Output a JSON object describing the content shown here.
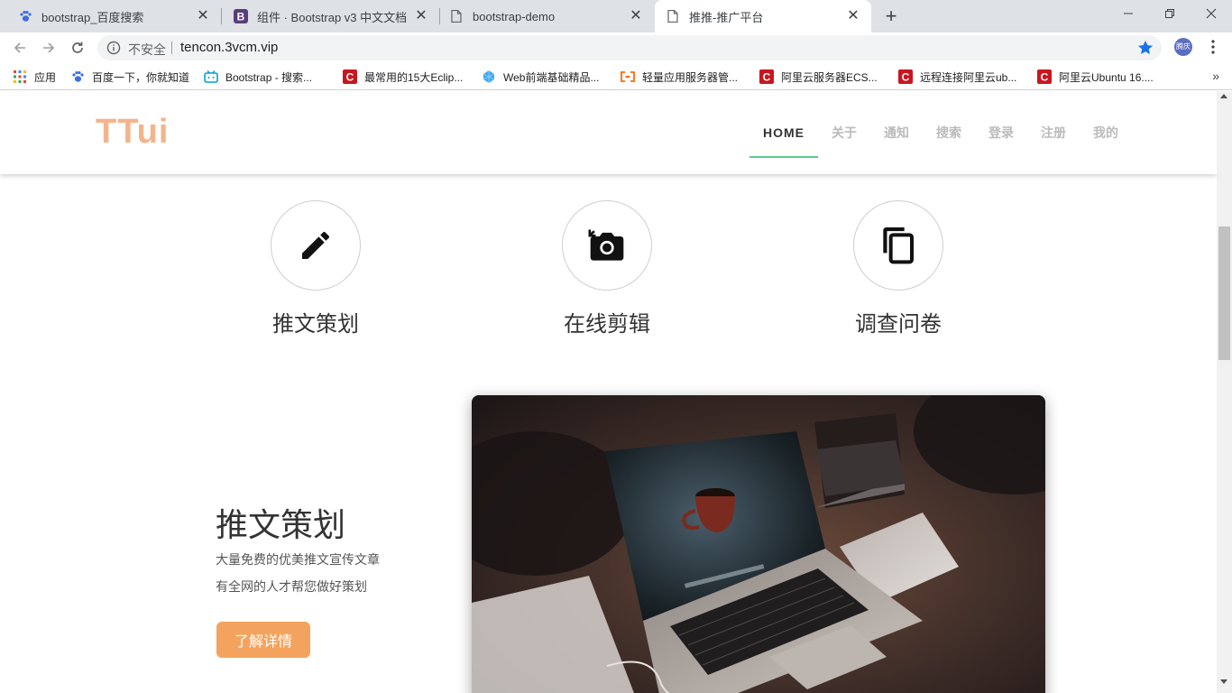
{
  "browser": {
    "tabs": [
      {
        "title": "bootstrap_百度搜索",
        "icon": "baidu-paw-icon",
        "close": "✕"
      },
      {
        "title": "组件 · Bootstrap v3 中文文档",
        "icon": "bootstrap-b-icon",
        "close": "✕"
      },
      {
        "title": "bootstrap-demo",
        "icon": "page-icon",
        "close": "✕"
      },
      {
        "title": "推推-推广平台",
        "icon": "page-icon",
        "close": "✕"
      }
    ],
    "active_tab": 3,
    "new_tab": "+",
    "insecure_label": "不安全",
    "url": "tencon.3vcm.vip",
    "profile_label": "腾庆",
    "bookmarks": [
      {
        "label": "应用",
        "icon": "apps-grid-icon"
      },
      {
        "label": "百度一下，你就知道",
        "icon": "baidu-paw-icon"
      },
      {
        "label": "Bootstrap - 搜索...",
        "icon": "bilibili-tv-icon"
      },
      {
        "label": "最常用的15大Eclip...",
        "icon": "csdn-c-icon"
      },
      {
        "label": "Web前端基础精品...",
        "icon": "diamond-icon"
      },
      {
        "label": "轻量应用服务器管...",
        "icon": "aliyun-bracket-icon"
      },
      {
        "label": "阿里云服务器ECS...",
        "icon": "csdn-c-icon"
      },
      {
        "label": "远程连接阿里云ub...",
        "icon": "csdn-c-icon"
      },
      {
        "label": "阿里云Ubuntu 16....",
        "icon": "csdn-c-icon"
      }
    ],
    "bookmarks_more": "»"
  },
  "site": {
    "logo": "TTui",
    "nav": [
      {
        "label": "HOME",
        "active": true
      },
      {
        "label": "关于",
        "active": false
      },
      {
        "label": "通知",
        "active": false
      },
      {
        "label": "搜索",
        "active": false
      },
      {
        "label": "登录",
        "active": false
      },
      {
        "label": "注册",
        "active": false
      },
      {
        "label": "我的",
        "active": false
      }
    ],
    "features": [
      {
        "label": "推文策划",
        "icon": "pencil-icon"
      },
      {
        "label": "在线剪辑",
        "icon": "camera-rotate-icon"
      },
      {
        "label": "调查问卷",
        "icon": "copy-icon"
      }
    ],
    "promo": {
      "title": "推文策划",
      "line1": "大量免费的优美推文宣传文章",
      "line2": "有全网的人才帮您做好策划",
      "button": "了解详情"
    }
  },
  "colors": {
    "logo": "#f4b48a",
    "nav_active_underline": "#5cc98a",
    "promo_button": "#f4a35e"
  }
}
